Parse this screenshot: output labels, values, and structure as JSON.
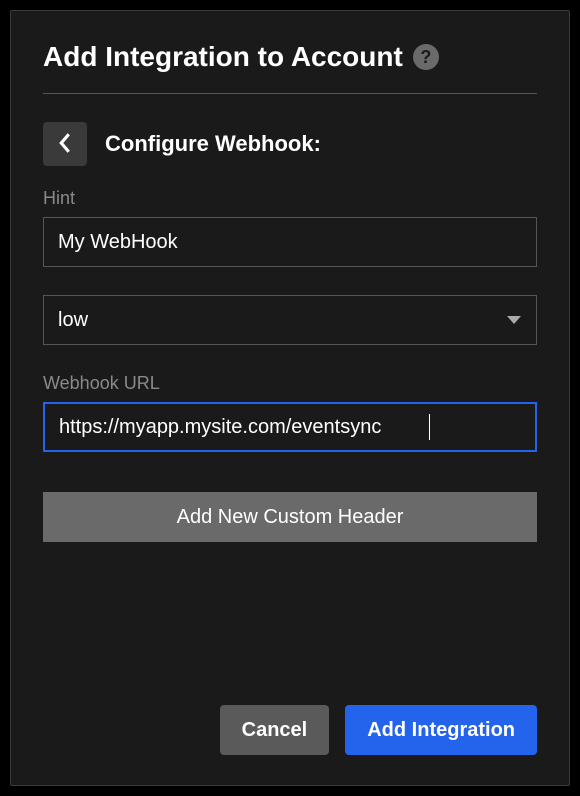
{
  "modal": {
    "title": "Add Integration to Account",
    "section_title": "Configure Webhook:"
  },
  "fields": {
    "hint": {
      "label": "Hint",
      "value": "My WebHook"
    },
    "priority": {
      "selected": "low"
    },
    "url": {
      "label": "Webhook URL",
      "value": "https://myapp.mysite.com/eventsync"
    }
  },
  "buttons": {
    "add_header": "Add New Custom Header",
    "cancel": "Cancel",
    "submit": "Add Integration"
  }
}
